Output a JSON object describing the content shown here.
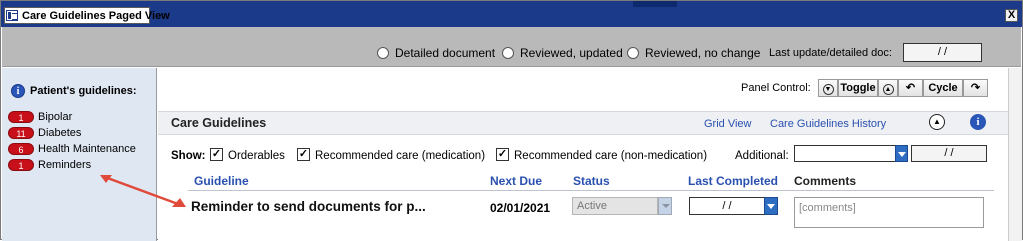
{
  "window": {
    "title": "Care Guidelines Paged View",
    "close_glyph": "X"
  },
  "top_options": {
    "radios": [
      {
        "label": "Detailed document"
      },
      {
        "label": "Reviewed, updated"
      },
      {
        "label": "Reviewed, no change"
      }
    ],
    "last_update_label": "Last update/detailed doc:",
    "last_update_value": "/ /"
  },
  "sidebar": {
    "header": "Patient's guidelines:",
    "items": [
      {
        "count": "1",
        "label": "Bipolar"
      },
      {
        "count": "11",
        "label": "Diabetes"
      },
      {
        "count": "6",
        "label": "Health Maintenance"
      },
      {
        "count": "1",
        "label": "Reminders"
      }
    ]
  },
  "panel_control": {
    "label": "Panel Control:",
    "toggle_label": "Toggle",
    "cycle_label": "Cycle"
  },
  "care_guidelines": {
    "title": "Care Guidelines",
    "grid_view_link": "Grid View",
    "history_link": "Care Guidelines History"
  },
  "show_filters": {
    "show_label": "Show:",
    "checkboxes": [
      {
        "label": "Orderables",
        "checked": true
      },
      {
        "label": "Recommended care (medication)",
        "checked": true
      },
      {
        "label": "Recommended care (non-medication)",
        "checked": true
      }
    ],
    "additional_label": "Additional:",
    "additional_value": "",
    "additional_date": "/ /"
  },
  "table": {
    "columns": [
      "Guideline",
      "Next Due",
      "Status",
      "Last Completed",
      "Comments"
    ],
    "rows": [
      {
        "guideline": "Reminder to send documents for p...",
        "next_due": "02/01/2021",
        "status": "Active",
        "last_completed": "/ /",
        "comments_placeholder": "[comments]"
      }
    ]
  },
  "colors": {
    "titlebar": "#1c3a8a",
    "chrome": "#b9b9b9",
    "sidebar": "#dfe7f2",
    "badge": "#c8101a",
    "link": "#2a50b0",
    "annotation_arrow": "#e04a3a"
  }
}
